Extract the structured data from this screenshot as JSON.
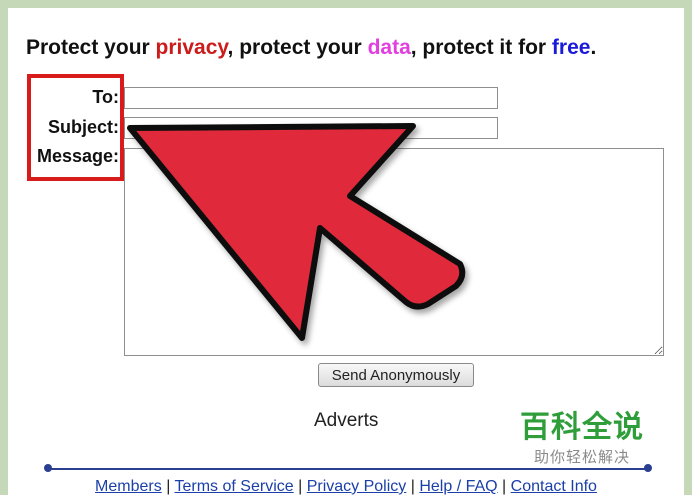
{
  "headline": {
    "part1": "Protect your ",
    "privacy": "privacy",
    "part2": ", protect your ",
    "data": "data",
    "part3": ", protect it for ",
    "free": "free",
    "part4": "."
  },
  "form": {
    "to_label": "To:",
    "subject_label": "Subject:",
    "message_label": "Message:",
    "to_value": "",
    "subject_value": "",
    "message_value": "",
    "send_label": "Send Anonymously"
  },
  "adverts": "Adverts",
  "footer": {
    "links": [
      "Members",
      "Terms of Service",
      "Privacy Policy",
      "Help / FAQ",
      "Contact Info"
    ],
    "separator": "|"
  },
  "watermark": {
    "title": "百科全说",
    "subtitle": "助你轻松解决"
  },
  "colors": {
    "privacy": "#cc1b1b",
    "data": "#e23fe0",
    "free": "#1a1ad8",
    "arrow": "#e02b3a",
    "highlight": "#d81c1c",
    "footer_link": "#1a3fa8"
  },
  "icons": [
    "red-pointer-arrow-icon",
    "resize-grip-icon"
  ]
}
